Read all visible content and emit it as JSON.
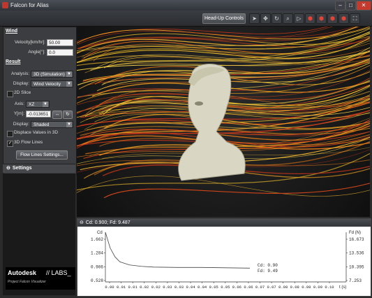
{
  "window": {
    "title": "Falcon for Alias"
  },
  "toolbar": {
    "hud_label": "Head-Up Controls",
    "tools": [
      "cursor-icon",
      "pan-icon",
      "rotate-icon",
      "zoom-icon",
      "play-icon",
      "view-front-icon",
      "view-side-icon",
      "view-top-icon",
      "view-iso-icon",
      "fit-icon"
    ]
  },
  "wind": {
    "heading": "Wind",
    "velocity_label": "Velocity[km/hr]:",
    "velocity_value": "50.00",
    "angle_label": "Angle[°]:",
    "angle_value": "0.0"
  },
  "result": {
    "heading": "Result",
    "analysis_label": "Analysis:",
    "analysis_value": "3D (Simulation)",
    "display_label": "Display:",
    "display_value": "Wind Velocity",
    "slice_label": "2D Slice",
    "axis_label": "Axis:",
    "axis_value": "XZ",
    "y_label": "Y[m]:",
    "y_value": "-0.013651",
    "display2_label": "Display:",
    "display2_value": "Shaded",
    "displace_label": "Displace Values in 3D",
    "flow_lines_label": "3D Flow Lines",
    "flow_lines_checked": true,
    "flow_settings_label": "Flow Lines Settings..."
  },
  "settings": {
    "label": "Settings"
  },
  "graph": {
    "header": "Cd: 0.900; Fd: 9.487",
    "readout_cd": "Cd: 0.90",
    "readout_fd": "Fd: 9.49"
  },
  "chart_data": {
    "type": "line",
    "xlabel": "t (s)",
    "x_ticks": [
      "0.00",
      "0.01",
      "0.01",
      "0.02",
      "0.02",
      "0.03",
      "0.03",
      "0.04",
      "0.04",
      "0.05",
      "0.05",
      "0.06",
      "0.06",
      "0.07",
      "0.07",
      "0.08",
      "0.08",
      "0.09",
      "0.09",
      "0.10"
    ],
    "y_left_label": "Cd",
    "y_left_ticks": [
      "1.662",
      "1.284",
      "0.906",
      "0.528"
    ],
    "y_right_label": "Fd (N)",
    "y_right_ticks": [
      "16.673",
      "13.536",
      "10.395",
      "7.253"
    ],
    "series": [
      {
        "x": [
          0.0,
          0.002,
          0.004,
          0.006,
          0.01,
          0.015,
          0.02,
          0.03,
          0.04,
          0.05,
          0.06
        ],
        "y": [
          1.9,
          1.45,
          1.2,
          1.06,
          0.97,
          0.93,
          0.91,
          0.9,
          0.9,
          0.89,
          0.88
        ]
      }
    ]
  },
  "branding": {
    "logo": "Autodesk",
    "labs": "// LABS_",
    "subtitle": "Project Falcon Visualizer"
  }
}
